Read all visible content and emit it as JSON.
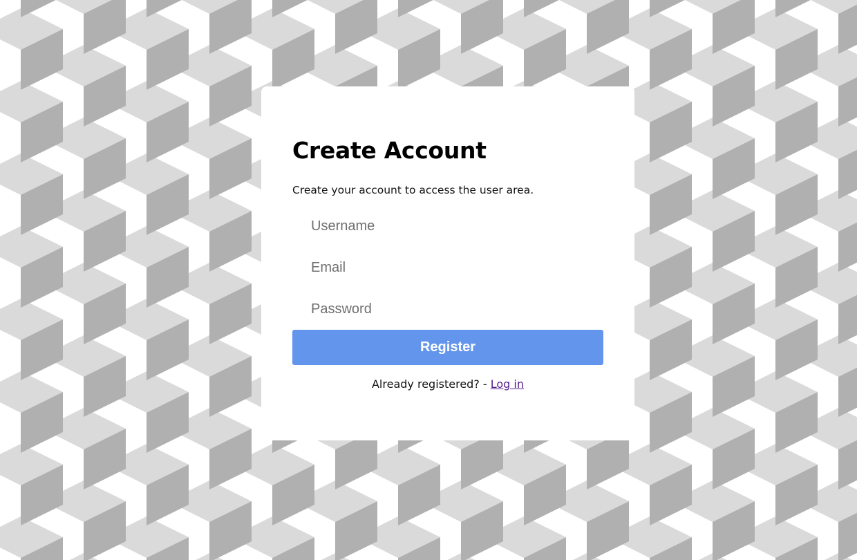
{
  "page": {
    "background_colors": {
      "light": "#dcdcdc",
      "dark": "#b0b0b0",
      "white": "#ffffff"
    }
  },
  "form": {
    "title": "Create Account",
    "subtitle": "Create your account to access the user area.",
    "username": {
      "placeholder": "Username",
      "value": ""
    },
    "email": {
      "placeholder": "Email",
      "value": ""
    },
    "password": {
      "placeholder": "Password",
      "value": ""
    },
    "register_label": "Register",
    "register_color": "#6495ed",
    "footer_prefix": "Already registered? - ",
    "login_link_label": "Log in",
    "link_color": "#551a8b"
  }
}
